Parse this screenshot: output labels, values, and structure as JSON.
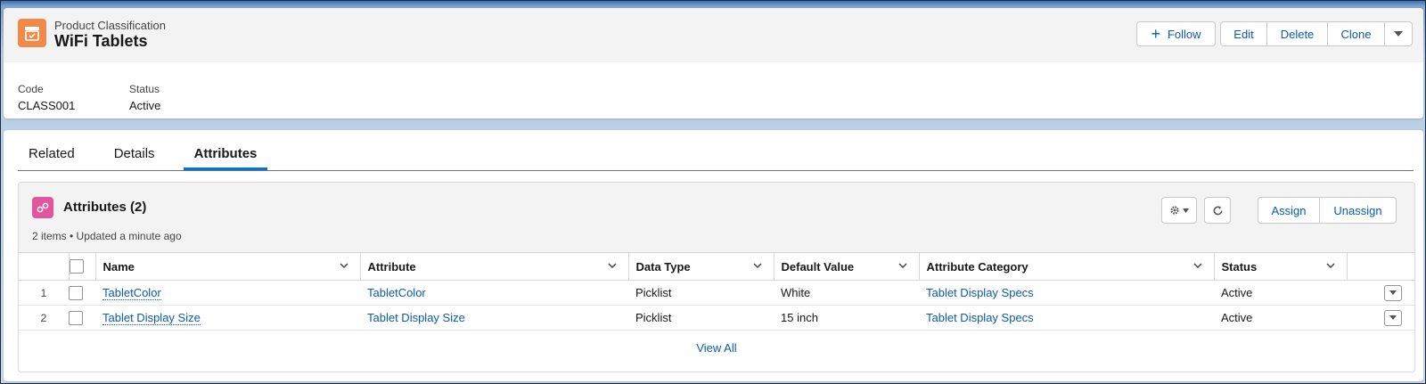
{
  "record": {
    "object_type": "Product Classification",
    "title": "WiFi Tablets",
    "actions": {
      "follow": "Follow",
      "edit": "Edit",
      "delete": "Delete",
      "clone": "Clone"
    },
    "highlights": [
      {
        "label": "Code",
        "value": "CLASS001"
      },
      {
        "label": "Status",
        "value": "Active"
      }
    ]
  },
  "tabs": [
    "Related",
    "Details",
    "Attributes"
  ],
  "active_tab": "Attributes",
  "related_list": {
    "title": "Attributes (2)",
    "subtitle": "2 items • Updated a minute ago",
    "buttons": {
      "assign": "Assign",
      "unassign": "Unassign"
    },
    "columns": [
      "Name",
      "Attribute",
      "Data Type",
      "Default Value",
      "Attribute Category",
      "Status"
    ],
    "rows": [
      {
        "num": "1",
        "name": "TabletColor",
        "attribute": "TabletColor",
        "data_type": "Picklist",
        "default_value": "White",
        "category": "Tablet Display Specs",
        "status": "Active"
      },
      {
        "num": "2",
        "name": "Tablet Display Size",
        "attribute": "Tablet Display Size",
        "data_type": "Picklist",
        "default_value": "15 inch",
        "category": "Tablet Display Specs",
        "status": "Active"
      }
    ],
    "view_all": "View All"
  },
  "colors": {
    "accent": "#0176d3",
    "link": "#0b5cab",
    "object_icon": "#f08a4b",
    "list_icon": "#e3559d"
  }
}
